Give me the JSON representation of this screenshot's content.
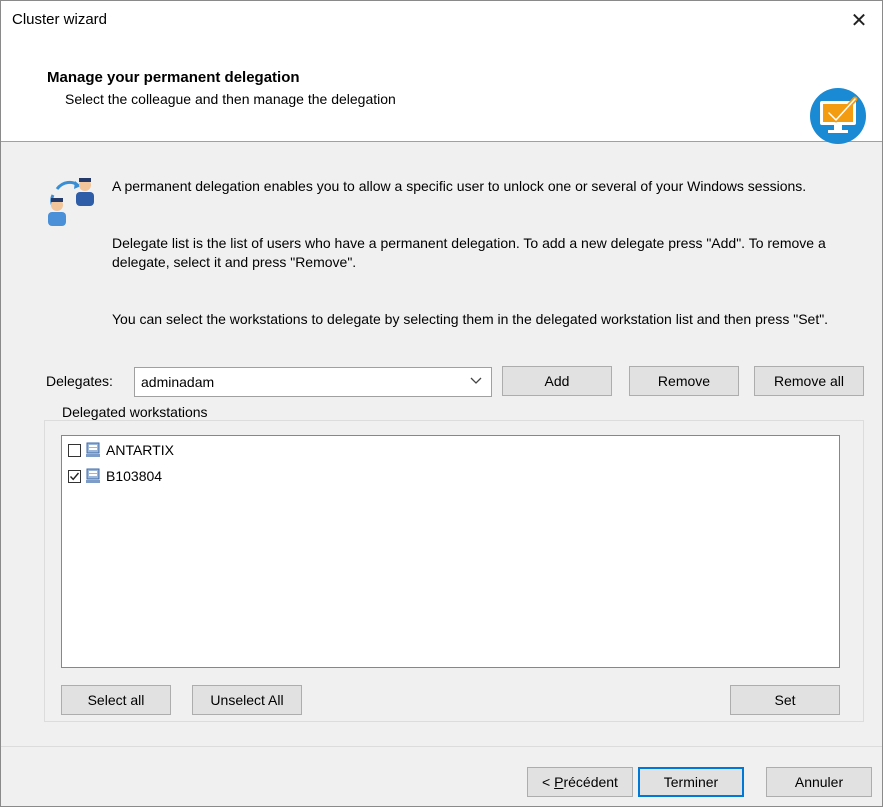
{
  "window": {
    "title": "Cluster wizard"
  },
  "header": {
    "title": "Manage your permanent delegation",
    "subtitle": "Select the colleague and then manage the delegation"
  },
  "info": {
    "paragraph1": "A permanent delegation enables you to allow a specific user to unlock one or several of your Windows sessions.",
    "paragraph2": "Delegate list is the list of users who have a permanent delegation. To add a new delegate press \"Add\". To remove a delegate, select it and press \"Remove\".",
    "paragraph3": "You can select the workstations to delegate by selecting them in the delegated workstation list and then press \"Set\"."
  },
  "delegates": {
    "label": "Delegates:",
    "selected": "adminadam",
    "add_label": "Add",
    "remove_label": "Remove",
    "remove_all_label": "Remove all"
  },
  "workstations": {
    "group_label": "Delegated workstations",
    "items": [
      {
        "name": "ANTARTIX",
        "checked": false
      },
      {
        "name": "B103804",
        "checked": true
      }
    ],
    "select_all_label": "Select all",
    "unselect_all_label": "Unselect All",
    "set_label": "Set"
  },
  "footer": {
    "back_underlined": "P",
    "back_rest": "récédent",
    "finish_label": "Terminer",
    "cancel_label": "Annuler"
  },
  "colors": {
    "accent": "#0078d7",
    "logo_orange": "#f39c12",
    "logo_blue": "#1a8ad4"
  }
}
